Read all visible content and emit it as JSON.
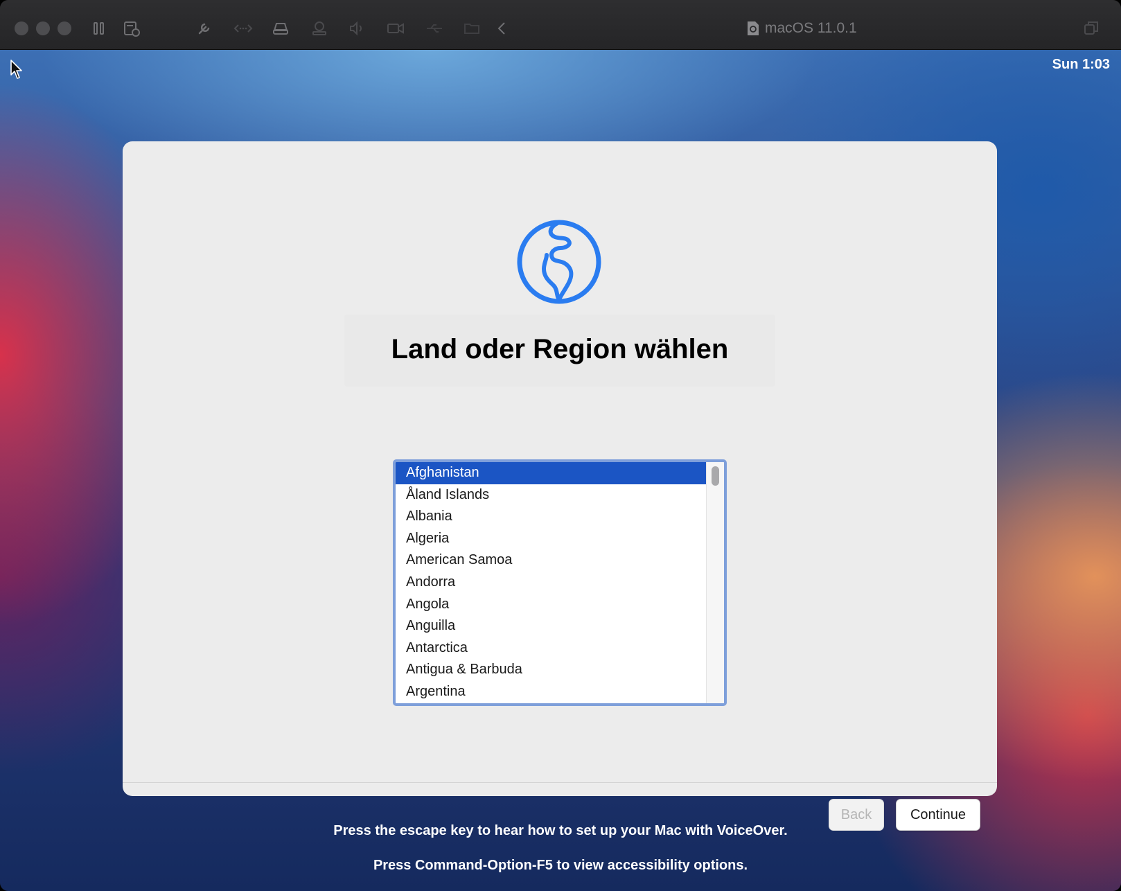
{
  "window": {
    "title": "macOS 11.0.1"
  },
  "menubar": {
    "clock": "Sun 1:03"
  },
  "setup": {
    "title": "Land oder Region wählen",
    "countries": [
      "Afghanistan",
      "Åland Islands",
      "Albania",
      "Algeria",
      "American Samoa",
      "Andorra",
      "Angola",
      "Anguilla",
      "Antarctica",
      "Antigua & Barbuda",
      "Argentina"
    ],
    "selected_country": "Afghanistan",
    "back_label": "Back",
    "continue_label": "Continue"
  },
  "hints": {
    "voiceover": "Press the escape key to hear how to set up your Mac with VoiceOver.",
    "accessibility": "Press Command-Option-F5 to view accessibility options."
  },
  "colors": {
    "accent": "#1b55c4",
    "globe": "#2a7cf0",
    "list_focus_ring": "#7e9fda"
  }
}
